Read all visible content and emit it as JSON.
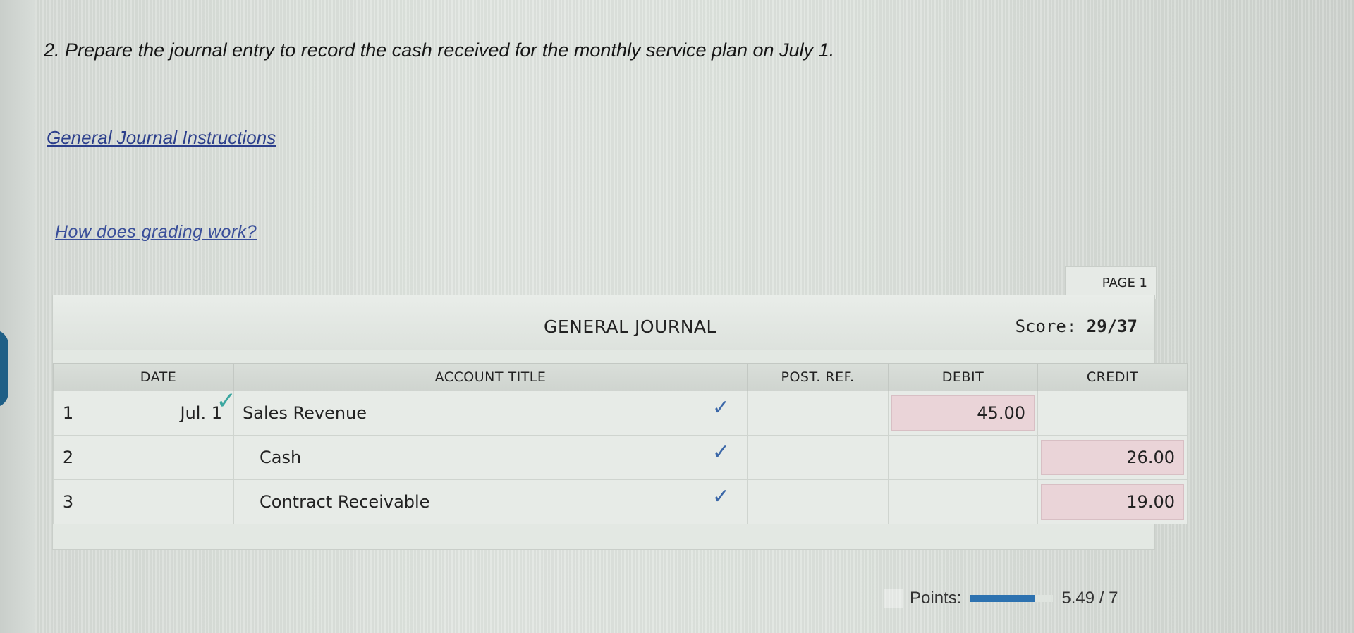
{
  "question": "2. Prepare the journal entry to record the cash received for the monthly service plan on July 1.",
  "links": {
    "instructions": "General Journal Instructions",
    "grading": "How does grading work?"
  },
  "journal": {
    "page_label": "PAGE 1",
    "title": "GENERAL JOURNAL",
    "score_label": "Score:",
    "score_value": "29/37",
    "columns": {
      "date": "DATE",
      "account_title": "ACCOUNT TITLE",
      "post_ref": "POST. REF.",
      "debit": "DEBIT",
      "credit": "CREDIT"
    },
    "rows": [
      {
        "num": "1",
        "date": "Jul. 1",
        "account": "Sales Revenue",
        "post_ref": "",
        "debit": "45.00",
        "credit": ""
      },
      {
        "num": "2",
        "date": "",
        "account": "Cash",
        "post_ref": "",
        "debit": "",
        "credit": "26.00"
      },
      {
        "num": "3",
        "date": "",
        "account": "Contract Receivable",
        "post_ref": "",
        "debit": "",
        "credit": "19.00"
      }
    ]
  },
  "points": {
    "label": "Points:",
    "value": "5.49 / 7",
    "progress_fraction": 0.784
  },
  "colors": {
    "link": "#2c3f8c",
    "check": "#3b67a8",
    "date_check": "#3ba7a0",
    "highlight_cell": "#ead4d8",
    "progress": "#2d72b0"
  },
  "icons": {
    "check": "checkmark-icon"
  }
}
